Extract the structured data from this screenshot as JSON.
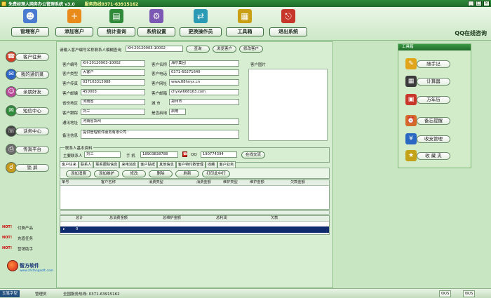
{
  "window": {
    "title": "免费经理人网务办公管理系统 v3.0",
    "hotline": "服务热线0371-63915162",
    "controls": [
      "_",
      "□",
      "×"
    ]
  },
  "toolbar": {
    "buttons": [
      {
        "label": "管理客户",
        "icon": "customers-icon",
        "color": "#4a7bd1"
      },
      {
        "label": "添加客户",
        "icon": "add-customer-icon",
        "color": "#e88b1b"
      },
      {
        "label": "统计查询",
        "icon": "statistics-icon",
        "color": "#2f8a3a"
      },
      {
        "label": "系统设置",
        "icon": "settings-icon",
        "color": "#7c58b5"
      },
      {
        "label": "更换操作员",
        "icon": "switch-operator-icon",
        "color": "#2b9bb5"
      },
      {
        "label": "工具箱",
        "icon": "toolbox-icon",
        "color": "#c9a013"
      },
      {
        "label": "退出系统",
        "icon": "exit-icon",
        "color": "#c7362a"
      }
    ],
    "qq_consult": "QQ在线咨询"
  },
  "sidebar": {
    "items": [
      {
        "label": "客户往来",
        "icon": "customer-contact-icon",
        "color": "#d1412a"
      },
      {
        "label": "我的通讯录",
        "icon": "address-book-icon",
        "color": "#2e66c7"
      },
      {
        "label": "亲朋好友",
        "icon": "friends-icon",
        "color": "#b94a9a"
      },
      {
        "label": "短信中心",
        "icon": "sms-icon",
        "color": "#2f8a3a"
      },
      {
        "label": "话务中心",
        "icon": "phone-icon",
        "color": "#3f3f3f"
      },
      {
        "label": "传真平台",
        "icon": "fax-icon",
        "color": "#6b6b6b"
      },
      {
        "label": "锁 屏",
        "icon": "lock-screen-icon",
        "color": "#c59a1f"
      }
    ],
    "hot_links": [
      {
        "badge": "HOT!",
        "label": "付费产品"
      },
      {
        "badge": "HOT!",
        "label": "充值任务"
      },
      {
        "badge": "HOT!",
        "label": "营销助手"
      }
    ],
    "brand_name": "智方软件",
    "brand_url": "www.zhifangsoft.com"
  },
  "main": {
    "search_label": "请输入客户编号名称联系人模糊查询",
    "search_value": "KH-20120903-10002",
    "search_buttons": [
      "查询",
      "浏览客户",
      "修改客户"
    ],
    "fields": {
      "customer_no_label": "客户编号",
      "customer_no": "KH-20120903-10002",
      "customer_name_label": "客户名称",
      "customer_name": "海尔集团",
      "customer_type_label": "客户类型",
      "customer_type": "大客户",
      "customer_phone_label": "客户电话",
      "customer_phone": "0371-60271640",
      "customer_fax_label": "客户传真",
      "customer_fax": "037163315988",
      "customer_site_label": "客户网址",
      "customer_site": "www.88hnyx.cn",
      "customer_zip_label": "客户邮编",
      "customer_zip": "450003",
      "customer_email_label": "客户邮箱",
      "customer_email": "chyxw668163.com",
      "province_label": "省份地区",
      "province": "河南省",
      "city_label": "城 市",
      "city": "郑州市",
      "follow_label": "客户跟踪",
      "follow": "刘三",
      "enabled_label": "是否启用",
      "enabled": "启用",
      "address_label": "通讯地址",
      "address": "河南省郑州",
      "remark_label": "备注信息",
      "remark": "提供管理软件服务有限公司",
      "photo_label": "客户图片"
    },
    "contact": {
      "legend": "联系人基本资料",
      "name_label": "主要联系人",
      "name": "刘三",
      "mobile_label": "手 机",
      "mobile": "18903838788",
      "qq_label": "QQ",
      "qq": "190774394",
      "chat_button": "在线交流"
    },
    "tabs": [
      "客户往来",
      "联系人",
      "联系跟踪信息",
      "来电消息",
      "客户贴纸",
      "其他信息",
      "客户特付数管理",
      "收藏",
      "客户业务"
    ],
    "actions": [
      "添加消费",
      "添加维护",
      "修改",
      "删除",
      "刷新",
      "打印此中行"
    ],
    "grid_columns": [
      "单号",
      "客户名称",
      "消费类型",
      "消费金额",
      "维护类型",
      "维护金额",
      "欠款金额"
    ],
    "summary_columns": [
      "总计",
      "总消费金额",
      "总维护金额",
      "总利润",
      "欠款"
    ],
    "summary_row": [
      "0",
      "",
      "",
      "",
      ""
    ]
  },
  "toolbox": {
    "title": "工具箱",
    "items": [
      {
        "label": "随手记",
        "icon": "notepad-icon",
        "color": "#e0a51a"
      },
      {
        "label": "计算器",
        "icon": "calculator-icon",
        "color": "#3b3b3b"
      },
      {
        "label": "万年历",
        "icon": "calendar-icon",
        "color": "#c9362a"
      },
      {
        "label": "备忘提醒",
        "icon": "memo-icon",
        "color": "#d46a2a"
      },
      {
        "label": "收支管理",
        "icon": "finance-icon",
        "color": "#2a67c2"
      },
      {
        "label": "收 藏 夹",
        "icon": "favorites-icon",
        "color": "#c3a21a"
      }
    ]
  },
  "status": {
    "tag": "五笔字型",
    "operator": "管理员",
    "service": "全国服务热线: 0371-63915162",
    "net_down": "0K/S",
    "net_up": "0K/S"
  }
}
